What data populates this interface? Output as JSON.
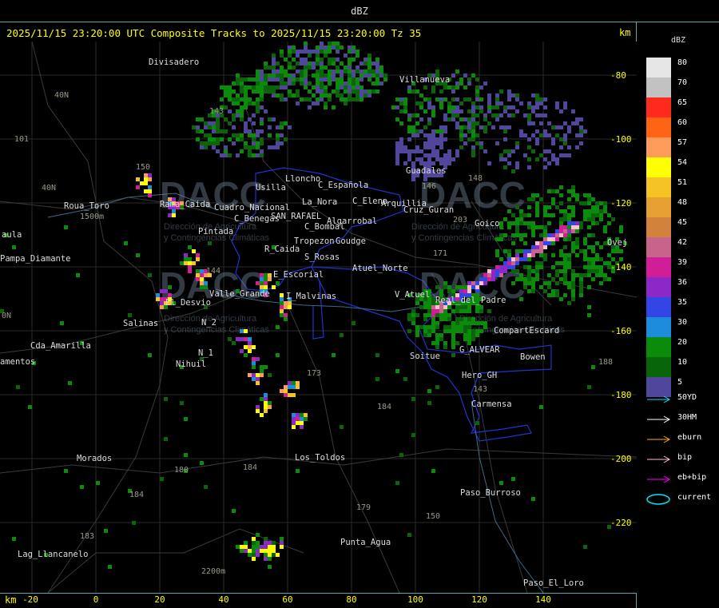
{
  "header": {
    "title": "dBZ"
  },
  "subheader": {
    "title": "2025/11/15 23:20:00 UTC Composite Tracks to 2025/11/15 23:20:00 Tz 35",
    "unit": "km"
  },
  "footer": {
    "unit": "km",
    "x_ticks": [
      "-20",
      "0",
      "20",
      "40",
      "60",
      "80",
      "100",
      "120",
      "140"
    ]
  },
  "y_ticks": [
    "-80",
    "-100",
    "-120",
    "-140",
    "-160",
    "-180",
    "-200",
    "-220"
  ],
  "legend": {
    "title": "dBZ",
    "scale": [
      {
        "label": "80",
        "color": "#e6e6e6"
      },
      {
        "label": "70",
        "color": "#c2c2c2"
      },
      {
        "label": "65",
        "color": "#ff2a1e"
      },
      {
        "label": "60",
        "color": "#ff6414"
      },
      {
        "label": "57",
        "color": "#ff9b5a"
      },
      {
        "label": "54",
        "color": "#ffff00"
      },
      {
        "label": "51",
        "color": "#f5c323"
      },
      {
        "label": "48",
        "color": "#e6a032"
      },
      {
        "label": "45",
        "color": "#d2823c"
      },
      {
        "label": "42",
        "color": "#c8648c"
      },
      {
        "label": "39",
        "color": "#d21e96"
      },
      {
        "label": "36",
        "color": "#8c28c8"
      },
      {
        "label": "35",
        "color": "#3246e6"
      },
      {
        "label": "30",
        "color": "#1e8cdc"
      },
      {
        "label": "20",
        "color": "#0a8c0a"
      },
      {
        "label": "10",
        "color": "#0a640a"
      },
      {
        "label": "5",
        "color": "#50469b"
      }
    ],
    "tracks": [
      {
        "label": "50YD",
        "color": "#00e5ff"
      },
      {
        "label": "30HM",
        "color": "#ffffff"
      },
      {
        "label": "eburn",
        "color": "#ffb000"
      },
      {
        "label": "bip",
        "color": "#ffc0cb"
      },
      {
        "label": "eb+bip",
        "color": "#ff00ff"
      },
      {
        "label": "current",
        "color": "#00e5ff"
      }
    ]
  },
  "watermark": {
    "logo_text": "DACC",
    "line1": "Dirección de Agricultura",
    "line2": "y Contingencias Climáticas"
  },
  "places": [
    "Divisadero",
    "Villanueva",
    "Guadales",
    "Lloncho",
    "Usilla",
    "C_Española",
    "C_Elena",
    "Arquillia",
    "Cruz_Guran",
    "Roua_Toro",
    "aula",
    "Pampa_Diamante",
    "Rama_Caida",
    "Cuadro_Nacional",
    "Pintada",
    "La_Nora",
    "C_Benegas",
    "SAN_RAFAEL",
    "Algarrobal",
    "C_Bombal",
    "Tropezon",
    "Goudge",
    "R_Caida",
    "S_Rosas",
    "Atuel_Norte",
    "Goico",
    "E_Escorial",
    "Valle_Grande",
    "I_Malvinas",
    "V_Atuel",
    "Real_del_Padre",
    "El_Desvio",
    "Salinas",
    "N_2",
    "N_1",
    "Nihuil",
    "Cda_Amarilla",
    "amentos",
    "Soitue",
    "G_ALVEAR",
    "CompartEscard",
    "Bowen",
    "Hero_GH",
    "Carmensa",
    "Morados",
    "Los_Toldos",
    "Paso_Burroso",
    "Punta_Agua",
    "Lag_Llancanelo",
    "Paso_El_Loro",
    "Ovej"
  ],
  "roads": [
    "40N",
    "101",
    "143",
    "150",
    "40N",
    "144",
    "173",
    "171",
    "203",
    "148",
    "184",
    "180",
    "184",
    "184",
    "183",
    "179",
    "150",
    "143",
    "146",
    "1500m",
    "2200m",
    "0N",
    "188"
  ]
}
